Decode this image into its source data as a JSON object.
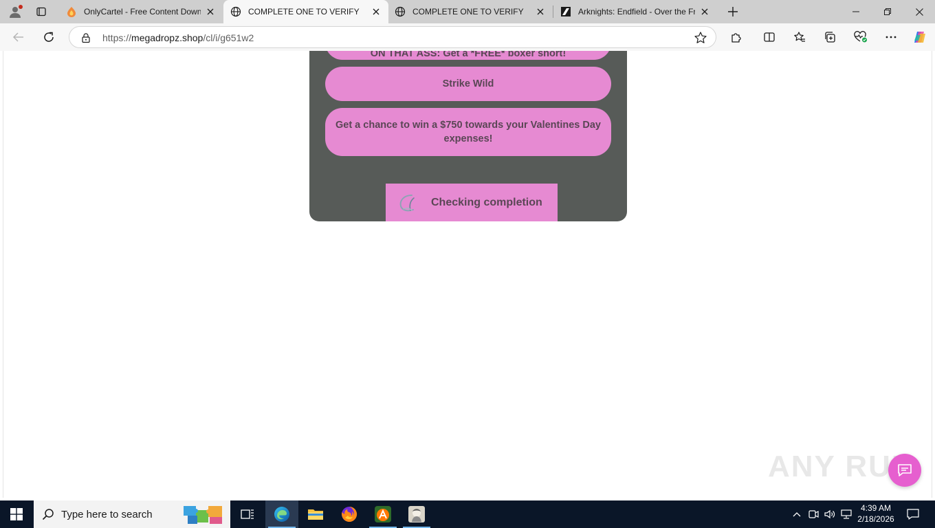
{
  "browser": {
    "tabs": [
      {
        "title": "OnlyCartel - Free Content Downlo",
        "active": false
      },
      {
        "title": "COMPLETE ONE TO VERIFY",
        "active": true
      },
      {
        "title": "COMPLETE ONE TO VERIFY",
        "active": false
      },
      {
        "title": "Arknights: Endfield - Over the Fro",
        "active": false
      }
    ],
    "address": {
      "scheme": "https://",
      "host": "megadropz.shop",
      "path": "/cl/i/g651w2"
    }
  },
  "page": {
    "offers": [
      {
        "label": "ON THAT ASS: Get a *FREE* boxer short!"
      },
      {
        "label": "Strike Wild"
      },
      {
        "label": "Get a chance to win a $750 towards your Valentines Day expenses!"
      }
    ],
    "status_label": "Checking completion",
    "watermark": "ANY RUN"
  },
  "taskbar": {
    "search_placeholder": "Type here to search",
    "time": "4:39 AM",
    "date": "2/18/2026"
  },
  "colors": {
    "panel": "#575b58",
    "offer_button": "#e68ad2",
    "offer_text": "#5a4655",
    "chat_bubble": "#e65fcf",
    "taskbar": "#0a1628"
  }
}
